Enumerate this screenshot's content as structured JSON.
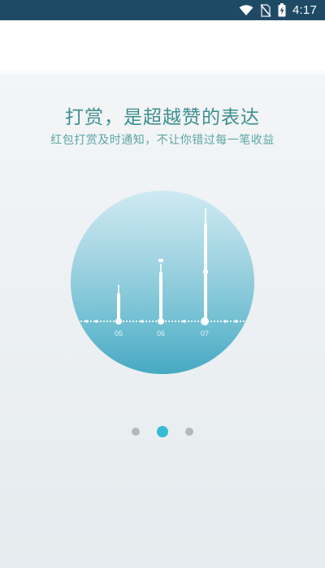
{
  "status_bar": {
    "time": "4:17",
    "icons": [
      "wifi-icon",
      "no-sim-icon",
      "battery-charging-icon"
    ]
  },
  "onboarding": {
    "title": "打赏，是超越赞的表达",
    "subtitle": "红包打赏及时通知，不让你错过每一笔收益",
    "illustration": {
      "axis_labels": [
        "05",
        "06",
        "07"
      ],
      "bar_relative_heights": [
        0.25,
        0.45,
        0.75
      ]
    },
    "pager": {
      "total": 3,
      "active_index": 1
    }
  },
  "colors": {
    "status_bar": "#1f4a66",
    "title_text": "#3c8f8f",
    "subtitle_text": "#5da6a6",
    "pager_active": "#35bcd2",
    "pager_inactive": "#b5b9bd"
  }
}
